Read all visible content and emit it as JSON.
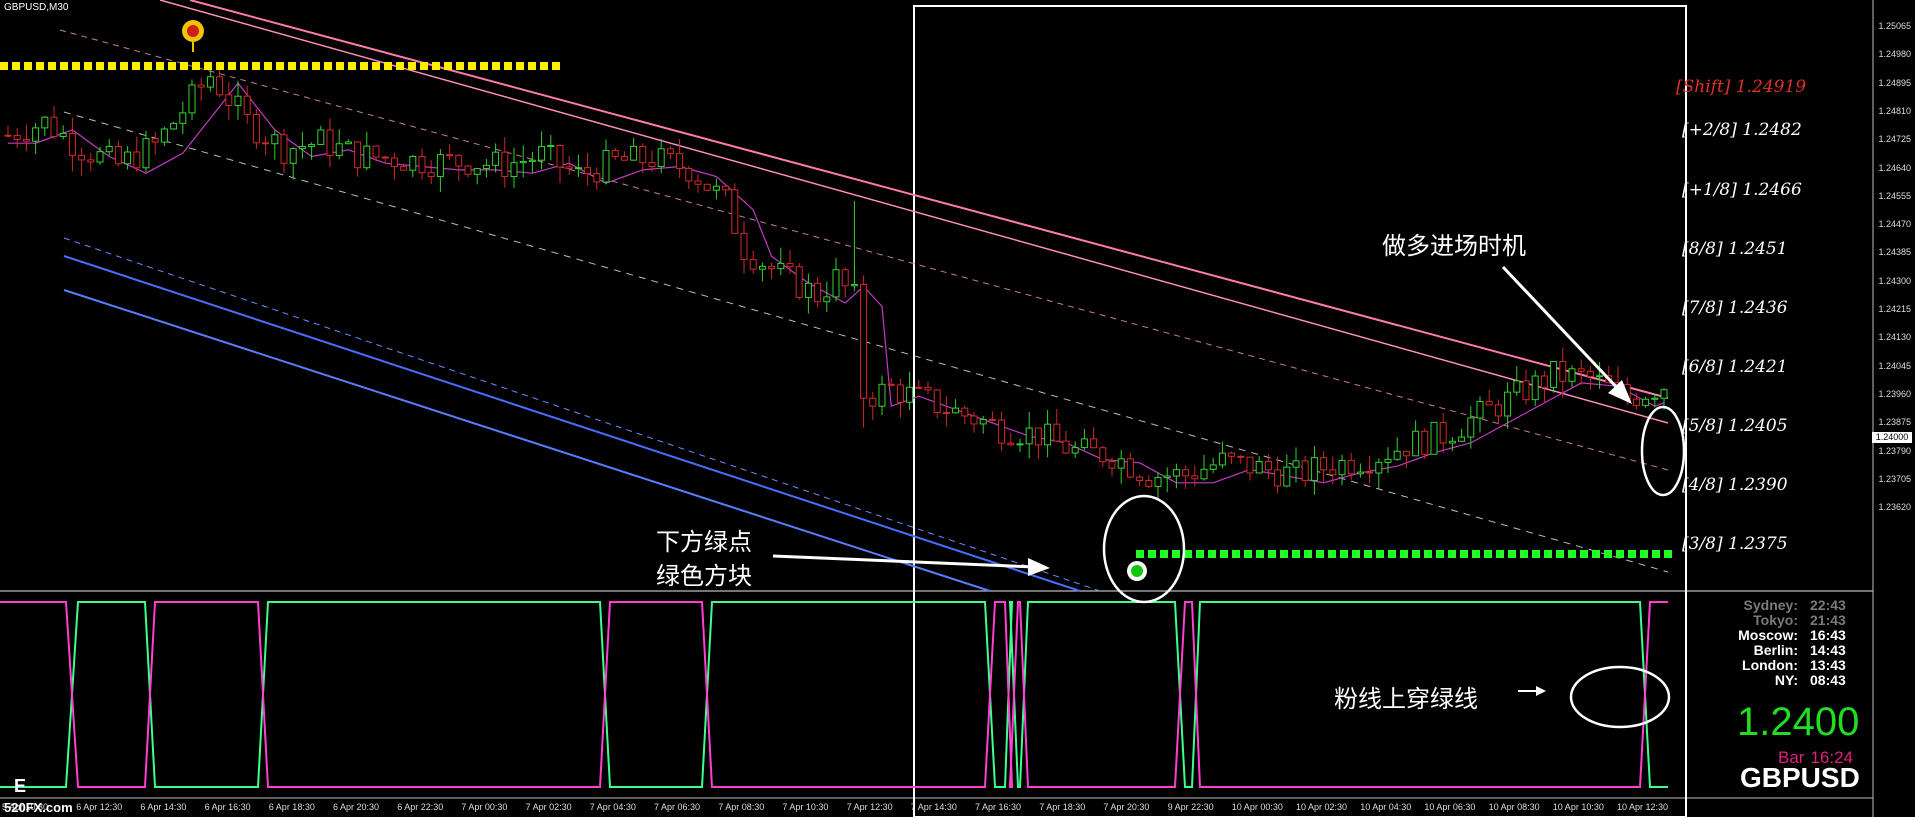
{
  "window": {
    "symbol": "GBPUSD,M30"
  },
  "colors": {
    "background": "#000000",
    "bull": "#32d232",
    "bear": "#d22828",
    "ma": "#c23ac2",
    "channel_upper": "#ff7bb0",
    "channel_lower": "#4a6cff",
    "osc_pink": "#ff3fcf",
    "osc_green": "#3dff8f",
    "signal_yellow": "#ffee00",
    "signal_green": "#22ff22"
  },
  "price_axis": [
    "1.25065",
    "1.24980",
    "1.24895",
    "1.24810",
    "1.24725",
    "1.24640",
    "1.24555",
    "1.24470",
    "1.24385",
    "1.24300",
    "1.24215",
    "1.24130",
    "1.24045",
    "1.23960",
    "1.23875",
    "1.23790",
    "1.23705",
    "1.23620"
  ],
  "current_price": "1.24000",
  "murrey": [
    {
      "label": "[Shift] 1.24919",
      "shift": true
    },
    {
      "label": "[+2/8] 1.2482"
    },
    {
      "label": "[+1/8] 1.2466"
    },
    {
      "label": "[8/8] 1.2451"
    },
    {
      "label": "[7/8] 1.2436"
    },
    {
      "label": "[6/8] 1.2421"
    },
    {
      "label": "[5/8] 1.2405"
    },
    {
      "label": "[4/8] 1.2390"
    },
    {
      "label": "[3/8] 1.2375"
    }
  ],
  "time_axis": [
    "5 Apr 10:30",
    "6 Apr 12:30",
    "6 Apr 14:30",
    "6 Apr 16:30",
    "6 Apr 18:30",
    "6 Apr 20:30",
    "6 Apr 22:30",
    "7 Apr 00:30",
    "7 Apr 02:30",
    "7 Apr 04:30",
    "7 Apr 06:30",
    "7 Apr 08:30",
    "7 Apr 10:30",
    "7 Apr 12:30",
    "7 Apr 14:30",
    "7 Apr 16:30",
    "7 Apr 18:30",
    "7 Apr 20:30",
    "9 Apr 22:30",
    "10 Apr 00:30",
    "10 Apr 02:30",
    "10 Apr 04:30",
    "10 Apr 06:30",
    "10 Apr 08:30",
    "10 Apr 10:30",
    "10 Apr 12:30"
  ],
  "annotations": {
    "entry_timing": "做多进场时机",
    "green_dot_line1": "下方绿点",
    "green_dot_line2": "绿色方块",
    "cross_note": "粉线上穿绿线"
  },
  "clock": [
    {
      "city": "Sydney:",
      "time": "22:43",
      "color": "#7a7a7a"
    },
    {
      "city": "Tokyo:",
      "time": "21:43",
      "color": "#7a7a7a"
    },
    {
      "city": "Moscow:",
      "time": "16:43",
      "color": "#ffffff"
    },
    {
      "city": "Berlin:",
      "time": "14:43",
      "color": "#ffffff"
    },
    {
      "city": "London:",
      "time": "13:43",
      "color": "#ffffff"
    },
    {
      "city": "NY:",
      "time": "08:43",
      "color": "#ffffff"
    }
  ],
  "bid": "1.2400",
  "bar_timer": {
    "label": "Bar",
    "value": "16:24"
  },
  "pair": "GBPUSD",
  "watermark": "520FX.com",
  "osc_marker": "E"
}
